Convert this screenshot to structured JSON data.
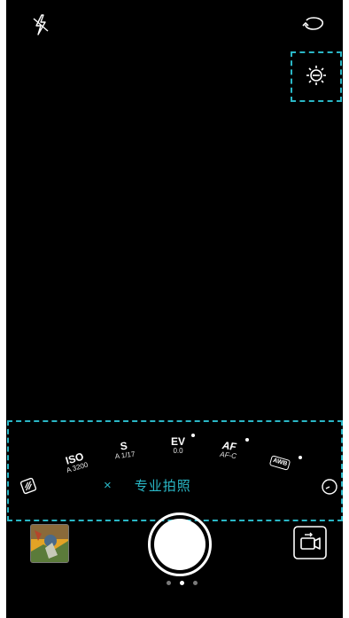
{
  "top_bar": {
    "flash_icon": "flash-off-icon",
    "switch_camera_icon": "switch-camera-icon",
    "settings_icon": "brightness-settings-icon"
  },
  "pro_params": [
    {
      "key": "ISO",
      "value": "A 3200"
    },
    {
      "key": "S",
      "value": "A 1/17"
    },
    {
      "key": "EV",
      "value": "0.0"
    },
    {
      "key": "AF",
      "value": "AF-C"
    },
    {
      "key": "AWB",
      "value": ""
    }
  ],
  "pro_mode": {
    "close": "×",
    "label": "专业拍照"
  },
  "pager": {
    "count": 3,
    "active_index": 1
  },
  "colors": {
    "accent": "#2ab7c6",
    "background": "#000000"
  }
}
